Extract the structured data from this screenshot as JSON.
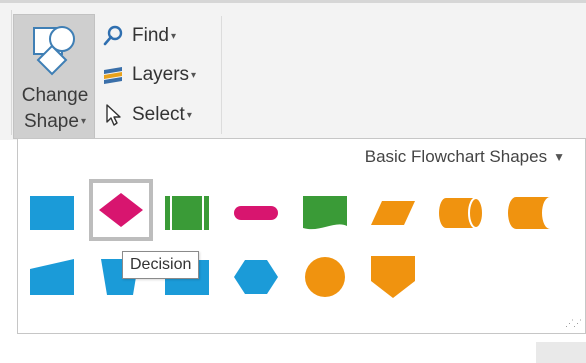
{
  "ribbon": {
    "change_shape": {
      "line1": "Change",
      "line2": "Shape"
    },
    "find_label": "Find",
    "layers_label": "Layers",
    "select_label": "Select"
  },
  "gallery": {
    "category": "Basic Flowchart Shapes",
    "tooltip": "Decision",
    "colors": {
      "blue": "#1b9bd8",
      "magenta": "#d8156f",
      "green": "#3a9b37",
      "orange": "#f0930f"
    },
    "shapes": [
      {
        "icon": "process-shape-icon",
        "color": "#1b9bd8"
      },
      {
        "icon": "decision-shape-icon",
        "color": "#d8156f",
        "selected": true
      },
      {
        "icon": "subprocess-shape-icon",
        "color": "#3a9b37"
      },
      {
        "icon": "terminator-shape-icon",
        "color": "#d8156f"
      },
      {
        "icon": "document-shape-icon",
        "color": "#3a9b37"
      },
      {
        "icon": "data-shape-icon",
        "color": "#f0930f"
      },
      {
        "icon": "database-shape-icon",
        "color": "#f0930f"
      },
      {
        "icon": "stored-data-shape-icon",
        "color": "#f0930f"
      },
      {
        "icon": "manual-input-shape-icon",
        "color": "#1b9bd8"
      },
      {
        "icon": "manual-operation-shape-icon",
        "color": "#1b9bd8"
      },
      {
        "icon": "predefined-process-shape-icon",
        "color": "#1b9bd8"
      },
      {
        "icon": "preparation-shape-icon",
        "color": "#1b9bd8"
      },
      {
        "icon": "connector-shape-icon",
        "color": "#f0930f"
      },
      {
        "icon": "off-page-connector-shape-icon",
        "color": "#f0930f"
      }
    ]
  }
}
